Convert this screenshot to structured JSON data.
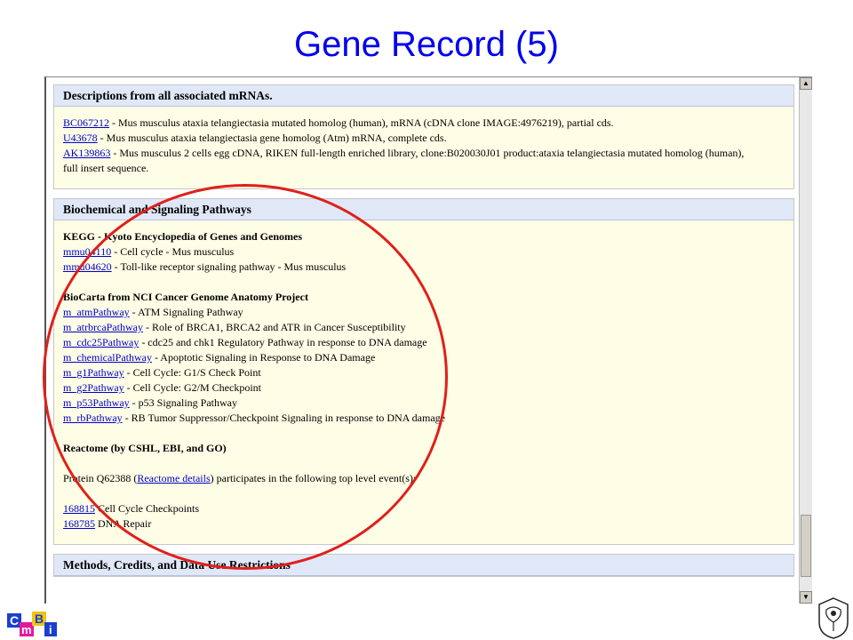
{
  "slide_title": "Gene Record (5)",
  "sections": {
    "mrna": {
      "heading": "Descriptions from all associated mRNAs.",
      "entries": [
        {
          "link": "BC067212",
          "text": " - Mus musculus ataxia telangiectasia mutated homolog (human), mRNA (cDNA clone IMAGE:4976219), partial cds."
        },
        {
          "link": "U43678",
          "text": " - Mus musculus ataxia telangiectasia gene homolog (Atm) mRNA, complete cds."
        },
        {
          "link": "AK139863",
          "text": " - Mus musculus 2 cells egg cDNA, RIKEN full-length enriched library, clone:B020030J01 product:ataxia telangiectasia mutated homolog (human), full insert sequence."
        }
      ]
    },
    "pathways": {
      "heading": "Biochemical and Signaling Pathways",
      "kegg": {
        "title": "KEGG - Kyoto Encyclopedia of Genes and Genomes",
        "entries": [
          {
            "link": "mmu04110",
            "text": " - Cell cycle - Mus musculus"
          },
          {
            "link": "mmu04620",
            "text": " - Toll-like receptor signaling pathway - Mus musculus"
          }
        ]
      },
      "biocarta": {
        "title": "BioCarta from NCI Cancer Genome Anatomy Project",
        "entries": [
          {
            "link": "m_atmPathway",
            "text": " - ATM Signaling Pathway"
          },
          {
            "link": "m_atrbrcaPathway",
            "text": " - Role of BRCA1, BRCA2 and ATR in Cancer Susceptibility"
          },
          {
            "link": "m_cdc25Pathway",
            "text": " - cdc25 and chk1 Regulatory Pathway in response to DNA damage"
          },
          {
            "link": "m_chemicalPathway",
            "text": " - Apoptotic Signaling in Response to DNA Damage"
          },
          {
            "link": "m_g1Pathway",
            "text": " - Cell Cycle: G1/S Check Point"
          },
          {
            "link": "m_g2Pathway",
            "text": " - Cell Cycle: G2/M Checkpoint"
          },
          {
            "link": "m_p53Pathway",
            "text": " - p53 Signaling Pathway"
          },
          {
            "link": "m_rbPathway",
            "text": " - RB Tumor Suppressor/Checkpoint Signaling in response to DNA damage"
          }
        ]
      },
      "reactome": {
        "title": "Reactome (by CSHL, EBI, and GO)",
        "protein_prefix": "Protein Q62388 (",
        "details_link": "Reactome details",
        "protein_suffix": ") participates in the following top level event(s):",
        "entries": [
          {
            "link": "168815",
            "text": " Cell Cycle Checkpoints"
          },
          {
            "link": "168785",
            "text": " DNA Repair"
          }
        ]
      }
    },
    "methods": {
      "heading": "Methods, Credits, and Data Use Restrictions"
    }
  },
  "logo": {
    "letters": [
      "C",
      "m",
      "B",
      "i"
    ],
    "colors": [
      "#1a3fd0",
      "#e3199b",
      "#f1c40f",
      "#1a3fd0"
    ]
  },
  "colors": {
    "title": "#0000ee",
    "highlight_circle": "#e0201a",
    "section_header_bg": "#e0e8f8",
    "section_body_bg": "#fefde6",
    "link": "#0000cc"
  }
}
